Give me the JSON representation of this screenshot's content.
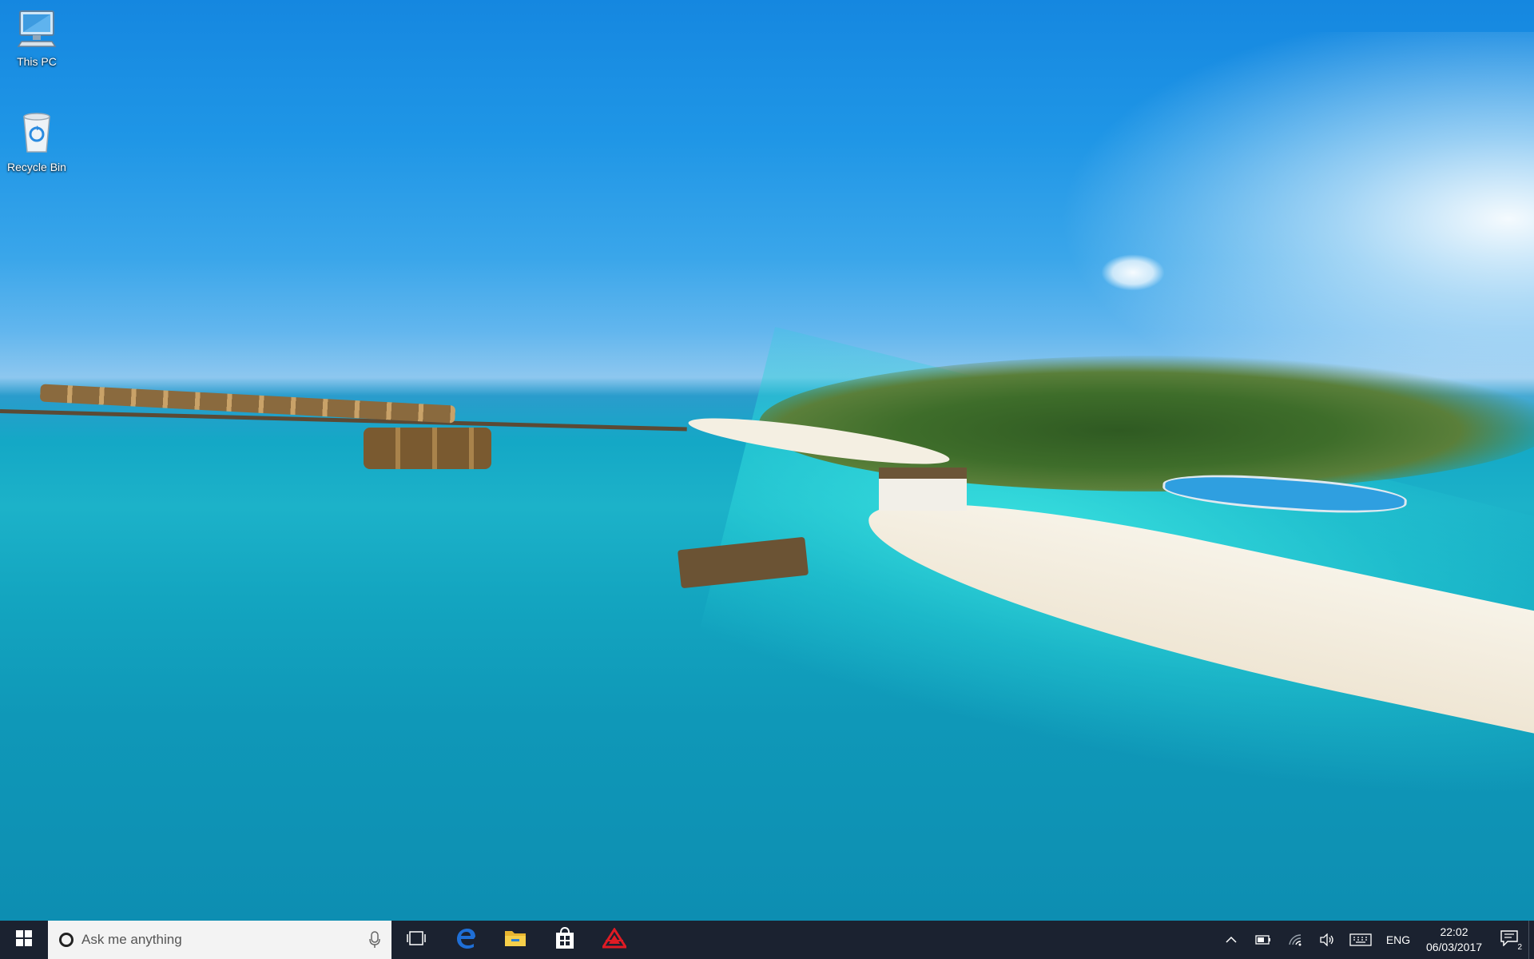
{
  "desktop": {
    "icons": [
      {
        "label": "This PC",
        "icon": "computer-icon"
      },
      {
        "label": "Recycle Bin",
        "icon": "recycle-bin-icon"
      }
    ],
    "wallpaper": "tropical-island-wallpaper"
  },
  "taskbar": {
    "start_icon": "windows-logo-icon",
    "search": {
      "placeholder": "Ask me anything",
      "mic_icon": "microphone-icon"
    },
    "task_view_icon": "task-view-icon",
    "pinned": [
      {
        "name": "edge",
        "icon": "edge-browser-icon",
        "color": "#1f6fd6"
      },
      {
        "name": "file-explorer",
        "icon": "folder-icon",
        "color": "#f2c23b"
      },
      {
        "name": "store",
        "icon": "store-bag-icon",
        "color": "#ffffff"
      },
      {
        "name": "app",
        "icon": "red-triangle-app-icon",
        "color": "#e01b24"
      }
    ],
    "tray": {
      "chevron_icon": "chevron-up-icon",
      "battery_icon": "battery-icon",
      "wifi_icon": "wifi-icon",
      "volume_icon": "volume-icon",
      "keyboard_icon": "touch-keyboard-icon",
      "language": "ENG",
      "time": "22:02",
      "date": "06/03/2017",
      "notification_count": "2"
    }
  },
  "colors": {
    "taskbar_bg": "#1b2230",
    "search_bg": "#f3f3f3"
  }
}
